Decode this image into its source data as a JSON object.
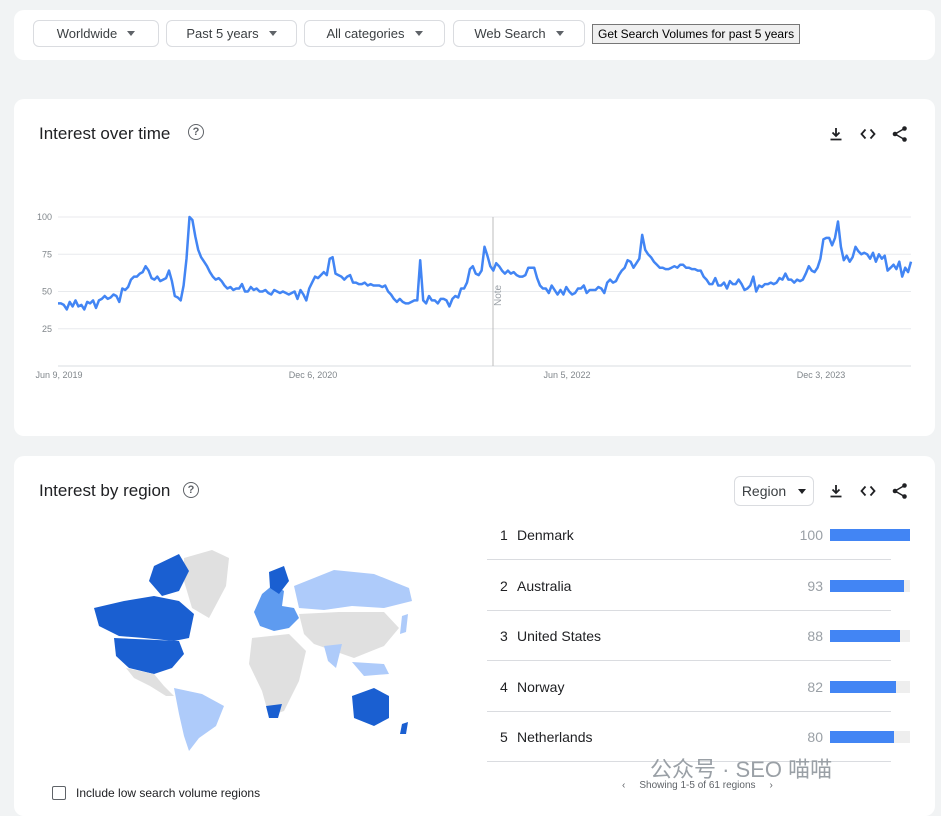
{
  "filters": {
    "region": "Worldwide",
    "time": "Past 5 years",
    "category": "All categories",
    "property": "Web Search",
    "get_volumes_button": "Get Search Volumes for past 5 years"
  },
  "interest_over_time": {
    "title": "Interest over time",
    "help_glyph": "?",
    "note_label": "Note"
  },
  "chart_data": {
    "type": "line",
    "x_tick_labels": [
      "Jun 9, 2019",
      "Dec 6, 2020",
      "Jun 5, 2022",
      "Dec 3, 2023"
    ],
    "y_tick_labels": [
      "100",
      "75",
      "50",
      "25"
    ],
    "ylim": [
      0,
      100
    ],
    "grid": true,
    "series_color": "#4285f4",
    "series": [
      {
        "name": "",
        "values": [
          42,
          42,
          41,
          38,
          43,
          40,
          44,
          40,
          41,
          38,
          43,
          42,
          44,
          39,
          44,
          45,
          47,
          45,
          46,
          48,
          47,
          43,
          52,
          51,
          53,
          58,
          60,
          60,
          62,
          63,
          67,
          64,
          59,
          58,
          60,
          57,
          58,
          59,
          64,
          57,
          47,
          46,
          44,
          54,
          72,
          100,
          98,
          87,
          78,
          73,
          70,
          67,
          63,
          60,
          58,
          59,
          57,
          54,
          52,
          53,
          51,
          52,
          52,
          55,
          50,
          50,
          53,
          51,
          52,
          50,
          50,
          51,
          49,
          48,
          51,
          50,
          49,
          50,
          49,
          48,
          49,
          50,
          45,
          51,
          48,
          44,
          52,
          56,
          60,
          59,
          61,
          63,
          61,
          72,
          73,
          62,
          61,
          60,
          58,
          60,
          61,
          56,
          56,
          55,
          55,
          56,
          54,
          55,
          54,
          54,
          54,
          53,
          54,
          50,
          48,
          45,
          43,
          45,
          43,
          42,
          42,
          43,
          44,
          44,
          71,
          44,
          42,
          47,
          44,
          44,
          42,
          45,
          45,
          44,
          40,
          45,
          47,
          46,
          52,
          52,
          56,
          65,
          67,
          62,
          61,
          64,
          80,
          74,
          67,
          64,
          69,
          67,
          64,
          62,
          64,
          62,
          63,
          61,
          60,
          60,
          61,
          66,
          66,
          66,
          59,
          54,
          52,
          52,
          49,
          54,
          51,
          48,
          51,
          48,
          53,
          50,
          48,
          49,
          52,
          52,
          54,
          49,
          51,
          51,
          51,
          53,
          52,
          49,
          56,
          58,
          56,
          57,
          61,
          64,
          66,
          71,
          70,
          66,
          69,
          72,
          88,
          78,
          75,
          73,
          70,
          68,
          66,
          66,
          65,
          65,
          66,
          67,
          66,
          68,
          68,
          66,
          66,
          65,
          65,
          64,
          64,
          60,
          58,
          55,
          55,
          59,
          54,
          54,
          56,
          52,
          57,
          55,
          55,
          58,
          55,
          51,
          52,
          54,
          60,
          50,
          54,
          53,
          55,
          55,
          56,
          55,
          56,
          59,
          58,
          62,
          58,
          58,
          56,
          58,
          57,
          58,
          62,
          67,
          64,
          63,
          66,
          72,
          85,
          86,
          86,
          81,
          86,
          97,
          80,
          71,
          74,
          70,
          73,
          80,
          77,
          75,
          76,
          75,
          72,
          76,
          70,
          75,
          72,
          74,
          64,
          66,
          68,
          65,
          70,
          60,
          66,
          63,
          70
        ]
      }
    ]
  },
  "interest_by_region": {
    "title": "Interest by region",
    "help_glyph": "?",
    "resolution_select": "Region",
    "rows": [
      {
        "rank": "1",
        "name": "Denmark",
        "value": 100
      },
      {
        "rank": "2",
        "name": "Australia",
        "value": 93
      },
      {
        "rank": "3",
        "name": "United States",
        "value": 88
      },
      {
        "rank": "4",
        "name": "Norway",
        "value": 82
      },
      {
        "rank": "5",
        "name": "Netherlands",
        "value": 80
      }
    ],
    "pager_text": "Showing 1-5 of 61 regions",
    "pager_prev": "‹",
    "pager_next": "›",
    "low_volume_checkbox_label": "Include low search volume regions",
    "low_volume_checked": false,
    "map_colors": {
      "high": "#1a5fd1",
      "medium": "#5e9bf0",
      "low": "#aecbfa",
      "none": "#e0e0e0"
    }
  },
  "tool_icons": [
    "download-icon",
    "embed-code-icon",
    "share-icon"
  ],
  "watermark": "公众号 · SEO 喵喵"
}
